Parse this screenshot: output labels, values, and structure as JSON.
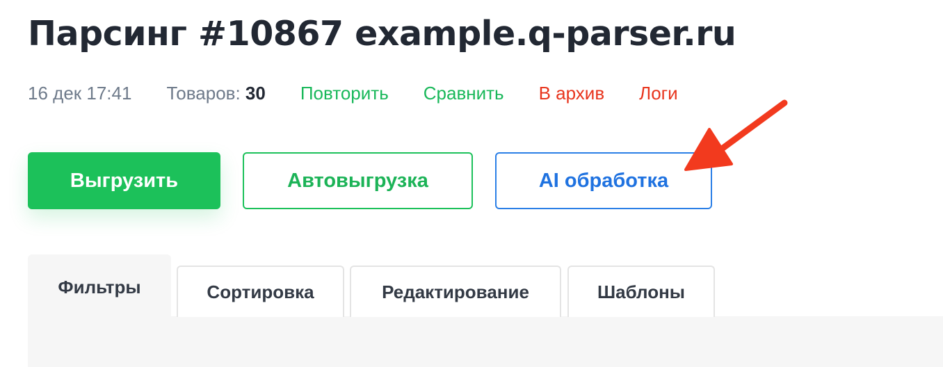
{
  "header": {
    "title": "Парсинг #10867 example.q-parser.ru"
  },
  "meta": {
    "date": "16 дек 17:41",
    "items_label": "Товаров:",
    "items_count": "30",
    "links": {
      "repeat": "Повторить",
      "compare": "Сравнить",
      "archive": "В архив",
      "logs": "Логи"
    }
  },
  "actions": {
    "export": "Выгрузить",
    "auto_export": "Автовыгрузка",
    "ai_processing": "AI обработка"
  },
  "tabs": [
    {
      "label": "Фильтры",
      "active": true
    },
    {
      "label": "Сортировка",
      "active": false
    },
    {
      "label": "Редактирование",
      "active": false
    },
    {
      "label": "Шаблоны",
      "active": false
    }
  ],
  "colors": {
    "primary_green": "#1cc15a",
    "link_green": "#19b85a",
    "danger_red": "#e8341c",
    "ai_blue": "#2b7fe6",
    "arrow_red": "#f23a1e",
    "title_dark": "#222833",
    "muted_gray": "#6e7a8a"
  },
  "icons": {
    "annotation": "red-arrow-pointer"
  }
}
